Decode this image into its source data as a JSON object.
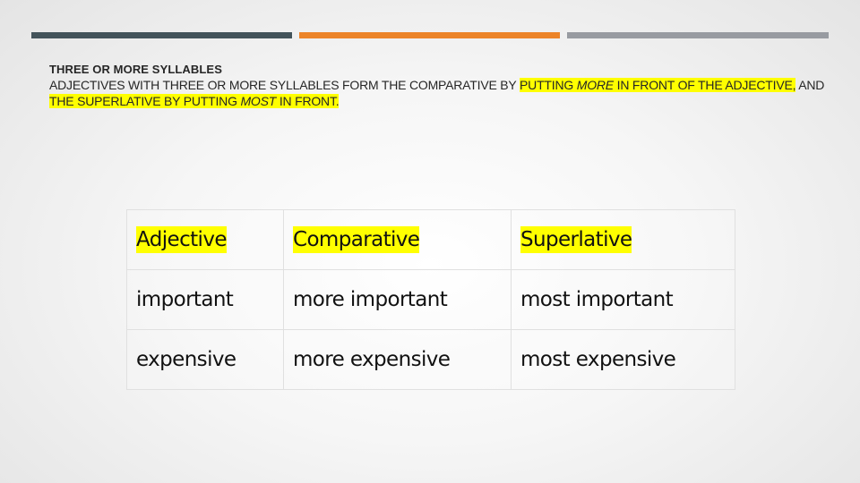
{
  "decorative_bars": [
    {
      "name": "dark-slate",
      "color": "#43535a"
    },
    {
      "name": "orange",
      "color": "#ec8429"
    },
    {
      "name": "gray",
      "color": "#989ba1"
    }
  ],
  "highlight_color": "#ffff00",
  "slide": {
    "heading": "THREE OR MORE SYLLABLES",
    "body": {
      "part1": "ADJECTIVES WITH THREE OR MORE SYLLABLES FORM THE COMPARATIVE BY ",
      "hl1_a": "PUTTING ",
      "hl1_italic": "MORE",
      "hl1_b": " IN FRONT OF THE ADJECTIVE,",
      "part2": " AND ",
      "hl2_a": "THE SUPERLATIVE BY PUTTING ",
      "hl2_italic": "MOST",
      "hl2_b": " IN FRONT."
    }
  },
  "table": {
    "headers": [
      "Adjective",
      "Comparative",
      "Superlative"
    ],
    "rows": [
      [
        "important",
        "more important",
        "most important"
      ],
      [
        "expensive",
        "more expensive",
        "most expensive"
      ]
    ]
  }
}
